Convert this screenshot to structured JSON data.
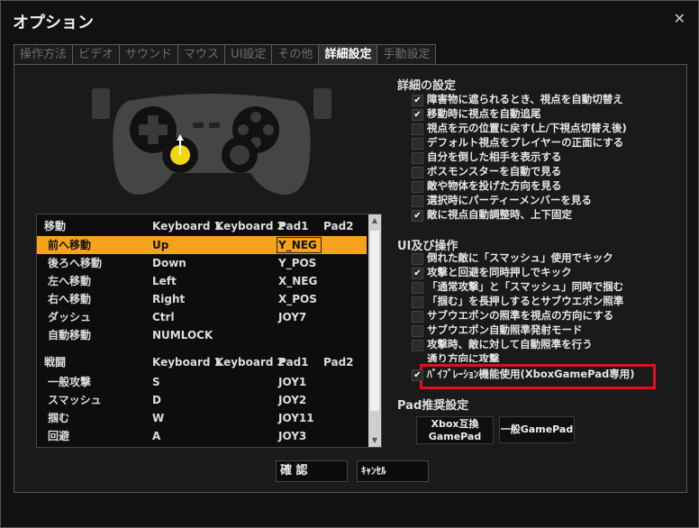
{
  "window": {
    "title": "オプション",
    "close_icon": "close-icon"
  },
  "tabs": [
    {
      "label": "操作方法",
      "active": false
    },
    {
      "label": "ビデオ",
      "active": false
    },
    {
      "label": "サウンド",
      "active": false
    },
    {
      "label": "マウス",
      "active": false
    },
    {
      "label": "UI設定",
      "active": false
    },
    {
      "label": "その他",
      "active": false
    },
    {
      "label": "詳細設定",
      "active": true
    },
    {
      "label": "手動設定",
      "active": false
    }
  ],
  "bindings": {
    "movement": {
      "header": [
        "移動",
        "Keyboard 1",
        "Keyboard 2",
        "Pad1",
        "Pad2"
      ],
      "rows": [
        {
          "action": "前へ移動",
          "kb1": "Up",
          "kb2": "",
          "pad1": "Y_NEG",
          "pad2": "",
          "selected": true
        },
        {
          "action": "後ろへ移動",
          "kb1": "Down",
          "kb2": "",
          "pad1": "Y_POS",
          "pad2": ""
        },
        {
          "action": "左へ移動",
          "kb1": "Left",
          "kb2": "",
          "pad1": "X_NEG",
          "pad2": ""
        },
        {
          "action": "右へ移動",
          "kb1": "Right",
          "kb2": "",
          "pad1": "X_POS",
          "pad2": ""
        },
        {
          "action": "ダッシュ",
          "kb1": "Ctrl",
          "kb2": "",
          "pad1": "JOY7",
          "pad2": ""
        },
        {
          "action": "自動移動",
          "kb1": "NUMLOCK",
          "kb2": "",
          "pad1": "",
          "pad2": ""
        }
      ]
    },
    "combat": {
      "header": [
        "戦闘",
        "Keyboard 1",
        "Keyboard 2",
        "Pad1",
        "Pad2"
      ],
      "rows": [
        {
          "action": "一般攻撃",
          "kb1": "S",
          "kb2": "",
          "pad1": "JOY1",
          "pad2": ""
        },
        {
          "action": "スマッシュ",
          "kb1": "D",
          "kb2": "",
          "pad1": "JOY2",
          "pad2": ""
        },
        {
          "action": "掴む",
          "kb1": "W",
          "kb2": "",
          "pad1": "JOY11",
          "pad2": ""
        },
        {
          "action": "回避",
          "kb1": "A",
          "kb2": "",
          "pad1": "JOY3",
          "pad2": ""
        }
      ]
    }
  },
  "detail": {
    "title": "詳細の設定",
    "options": [
      {
        "label": "障害物に遮られるとき、視点を自動切替え",
        "checked": true
      },
      {
        "label": "移動時に視点を自動追尾",
        "checked": true
      },
      {
        "label": "視点を元の位置に戻す(上/下視点切替え後)",
        "checked": false
      },
      {
        "label": "デフォルト視点をプレイヤーの正面にする",
        "checked": false
      },
      {
        "label": "自分を倒した相手を表示する",
        "checked": false
      },
      {
        "label": "ボスモンスターを自動で見る",
        "checked": false
      },
      {
        "label": "敵や物体を投げた方向を見る",
        "checked": false
      },
      {
        "label": "選択時にパーティーメンバーを見る",
        "checked": false
      },
      {
        "label": "敵に視点自動調整時、上下固定",
        "checked": true
      }
    ]
  },
  "ui": {
    "title": "UI及び操作",
    "options": [
      {
        "label": "倒れた敵に「スマッシュ」使用でキック",
        "checked": false
      },
      {
        "label": "攻撃と回避を同時押しでキック",
        "checked": true
      },
      {
        "label": "「通常攻撃」と「スマッシュ」同時で掴む",
        "checked": false
      },
      {
        "label": "「掴む」を長押しするとサブウエポン照準",
        "checked": false
      },
      {
        "label": "サブウエポンの照準を視点の方向にする",
        "checked": false
      },
      {
        "label": "サブウエポン自動照準発射モード",
        "checked": false
      },
      {
        "label": "攻撃時、敵に対して自動照準を行う",
        "checked": false
      },
      {
        "label": "通り方向に攻撃",
        "checked": false
      },
      {
        "label": "ﾊﾞｲﾌﾞﾚｰｼｮﾝ機能使用(XboxGamePad専用)",
        "checked": true
      }
    ]
  },
  "pad": {
    "title": "Pad推奨設定",
    "buttons": [
      {
        "line1": "Xbox互換",
        "line2": "GamePad"
      },
      {
        "line1": "一般GamePad",
        "line2": ""
      }
    ]
  },
  "footer": {
    "confirm": "確 認",
    "cancel": "ｷｬﾝｾﾙ"
  },
  "colors": {
    "selection": "#f5a31a",
    "highlight_border": "#e01020",
    "background": "#1a1a1a"
  }
}
